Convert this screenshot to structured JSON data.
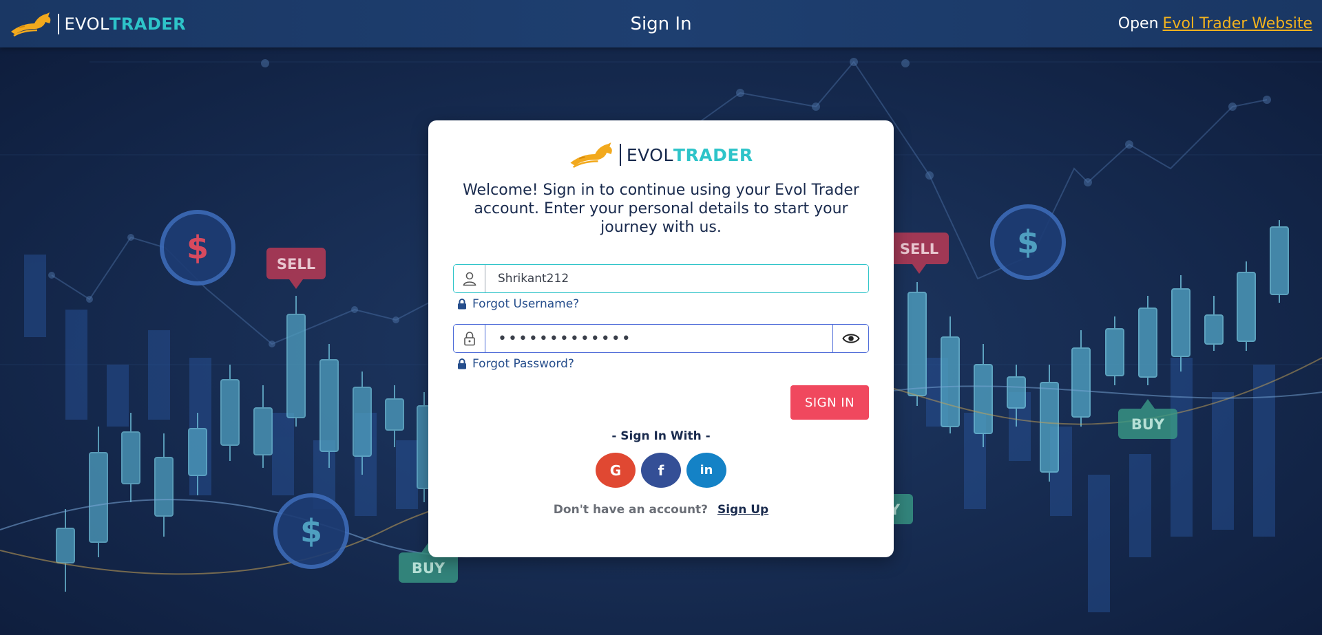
{
  "colors": {
    "header_bg": "#1e3f70",
    "background": "#14264a",
    "brand_teal": "#2ec4c9",
    "brand_orange": "#f2a91d",
    "link_gold": "#f2b21e",
    "sign_in_red": "#f0485e",
    "google_red": "#e04832",
    "facebook_blue": "#344f96",
    "linkedin_blue": "#1482c6"
  },
  "header": {
    "brand_word_a": "EVOL",
    "brand_word_b": "TRADER",
    "title": "Sign In",
    "open_prefix": "Open",
    "website_link": "Evol Trader Website"
  },
  "background_labels": {
    "sell": "SELL",
    "buy": "BUY",
    "dollar": "$"
  },
  "card": {
    "brand_word_a": "EVOL",
    "brand_word_b": "TRADER",
    "welcome": "Welcome! Sign in to continue using your Evol Trader account. Enter your personal details to start your journey with us.",
    "username": {
      "icon": "user-icon",
      "value": "Shrikant212"
    },
    "forgot_username": "Forgot Username?",
    "password": {
      "icon": "lock-icon",
      "value": "•••••••••••••",
      "toggle_icon": "eye-icon"
    },
    "forgot_password": "Forgot Password?",
    "sign_in_button": "SIGN IN",
    "sign_in_with": "- Sign In With -",
    "socials": [
      {
        "label": "G",
        "icon": "google-icon"
      },
      {
        "label": "f",
        "icon": "facebook-icon"
      },
      {
        "label": "in",
        "icon": "linkedin-icon"
      }
    ],
    "no_account": "Don't have an account?",
    "sign_up": "Sign Up"
  }
}
